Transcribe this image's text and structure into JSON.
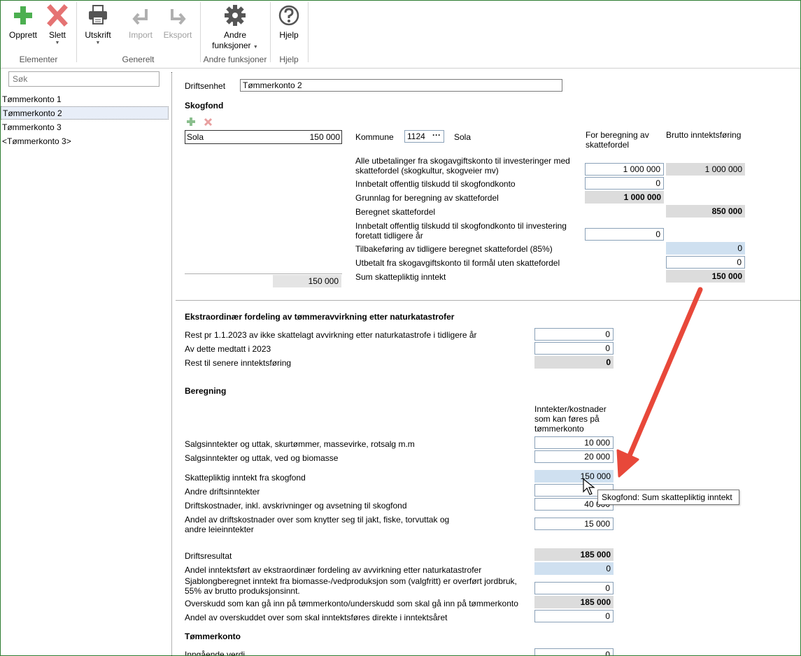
{
  "ribbon": {
    "opprett": "Opprett",
    "slett": "Slett",
    "utskrift": "Utskrift",
    "import": "Import",
    "eksport": "Eksport",
    "andre_l1": "Andre",
    "andre_l2": "funksjoner",
    "hjelp": "Hjelp",
    "groups": {
      "elementer": "Elementer",
      "generelt": "Generelt",
      "andre": "Andre funksjoner",
      "hjelp": "Hjelp"
    },
    "icons": [
      "plus-icon",
      "delete-x-icon",
      "printer-icon",
      "import-icon",
      "export-icon",
      "gear-icon",
      "help-icon"
    ],
    "colors": {
      "add": "#4caf50",
      "delete": "#e57373",
      "gear": "#555555"
    }
  },
  "sidebar": {
    "search_placeholder": "Søk",
    "items": [
      "Tømmerkonto 1",
      "Tømmerkonto 2",
      "Tømmerkonto 3",
      "<Tømmerkonto 3>"
    ],
    "selected_index": 1
  },
  "form": {
    "driftsenhet_label": "Driftsenhet",
    "driftsenhet_value": "Tømmerkonto 2",
    "skogfond": {
      "title": "Skogfond",
      "list_item_name": "Sola",
      "list_item_value": "150 000",
      "total": "150 000",
      "kommune_label": "Kommune",
      "kommune_code": "1124",
      "kommune_name": "Sola",
      "col1_header": "For beregning av skattefordel",
      "col2_header": "Brutto inntektsføring",
      "rows": {
        "alle_utbet": "Alle utbetalinger fra skogavgiftskonto til investeringer med skattefordel (skogkultur, skogveier mv)",
        "alle_utbet_v1": "1 000 000",
        "alle_utbet_v2": "1 000 000",
        "innbet_tilskudd": "Innbetalt offentlig tilskudd til skogfondkonto",
        "innbet_tilskudd_v1": "0",
        "grunnlag": "Grunnlag for beregning av skattefordel",
        "grunnlag_v1": "1 000 000",
        "beregnet": "Beregnet skattefordel",
        "beregnet_v2": "850 000",
        "innbet_tidl": "Innbetalt offentlig tilskudd til skogfondkonto til investering foretatt tidligere år",
        "innbet_tidl_v1": "0",
        "tilbakeforing": "Tilbakeføring av tidligere beregnet skattefordel  (85%)",
        "tilbakeforing_v2": "0",
        "utbetalt": "Utbetalt fra skogavgiftskonto til formål uten skattefordel",
        "utbetalt_v2": "0",
        "sum": "Sum skattepliktig inntekt",
        "sum_v2": "150 000"
      }
    },
    "ekstra": {
      "title": "Ekstraordinær fordeling av tømmeravvirkning etter naturkatastrofer",
      "rest_label": "Rest pr 1.1.2023 av ikke skattelagt avvirkning etter naturkatastrofe i tidligere år",
      "rest_value": "0",
      "medtatt_label": "Av dette medtatt i 2023",
      "medtatt_value": "0",
      "senere_label": "Rest til senere inntektsføring",
      "senere_value": "0"
    },
    "beregning": {
      "title": "Beregning",
      "col_header": "Inntekter/kostnader som kan føres på tømmerkonto",
      "salg1_label": "Salgsinntekter og uttak, skurtømmer, massevirke, rotsalg m.m",
      "salg1_value": "10 000",
      "salg2_label": "Salgsinntekter og uttak, ved og biomasse",
      "salg2_value": "20 000",
      "skattepl_label": "Skattepliktig inntekt fra skogfond",
      "skattepl_value": "150 000",
      "andre_label": "Andre driftsinntekter",
      "andre_value": "",
      "kostn_label": "Driftskostnader, inkl. avskrivninger og avsetning til skogfond",
      "kostn_value": "40 000",
      "andel_label": "Andel av driftskostnader over som knytter seg til jakt, fiske, torvuttak og andre leieinntekter",
      "andel_value": "15 000",
      "driftsres_label": "Driftsresultat",
      "driftsres_value": "185 000",
      "andel_innt_label": "Andel inntektsført av ekstraordinær fordeling av avvirkning etter naturkatastrofer",
      "andel_innt_value": "0",
      "sjablong_label": "Sjablongberegnet inntekt fra biomasse-/vedproduksjon som (valgfritt) er overført jordbruk, 55% av brutto produksjonsinnt.",
      "sjablong_value": "0",
      "overskudd_label": "Overskudd som kan gå inn på tømmerkonto/underskudd som skal gå inn på tømmerkonto",
      "overskudd_value": "185 000",
      "andel_over_label": "Andel av overskuddet over som skal inntektsføres direkte i inntektsåret",
      "andel_over_value": "0"
    },
    "tommerkonto": {
      "title": "Tømmerkonto",
      "inngaende_label": "Inngående verdi",
      "inngaende_value": "0"
    }
  },
  "tooltip": "Skogfond: Sum skattepliktig inntekt",
  "annotation": {
    "arrow_color": "#e8483a"
  }
}
